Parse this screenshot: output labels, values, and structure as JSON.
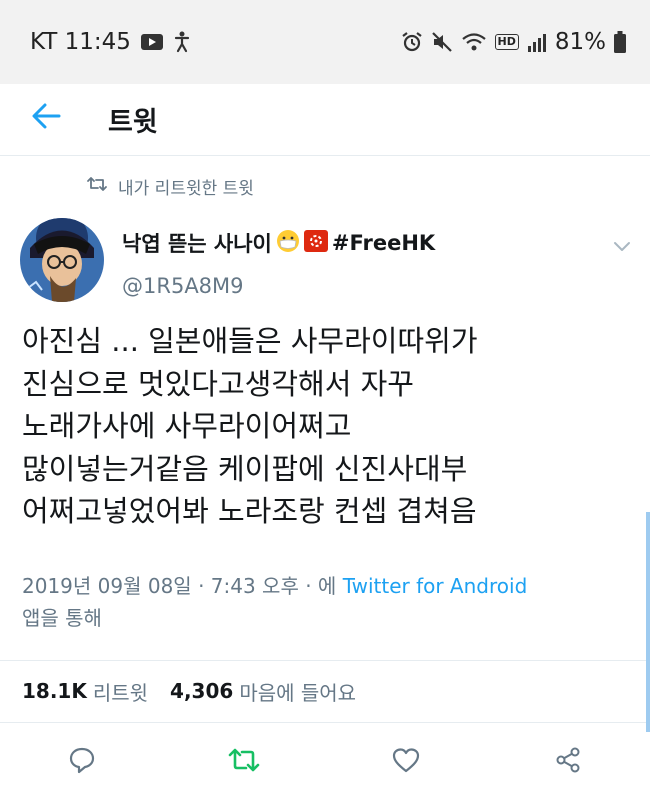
{
  "status_bar": {
    "carrier_time": "KT 11:45",
    "network_badge": "HD",
    "battery": "81%"
  },
  "header": {
    "title": "트윗"
  },
  "retweet_context": "내가 리트윗한 트윗",
  "author": {
    "name": "낙엽 뜯는 사나이",
    "hashtag": "#FreeHK",
    "handle": "@1R5A8M9"
  },
  "tweet": {
    "lines": [
      "아진심 ... 일본애들은 사무라이따위가",
      "진심으로 멋있다고생각해서 자꾸",
      "노래가사에 사무라이어쩌고",
      "많이넣는거같음 케이팝에 신진사대부",
      "어쩌고넣었어봐 노라조랑 컨셉 겹쳐음"
    ]
  },
  "meta": {
    "timestamp": "2019년 09월 08일 · 7:43 오후 · 에",
    "source": "Twitter for Android",
    "via": "앱을 통해"
  },
  "stats": {
    "retweets_count": "18.1K",
    "retweets_label": "리트윗",
    "likes_count": "4,306",
    "likes_label": "마음에 들어요"
  },
  "colors": {
    "accent": "#1da1f2",
    "retweet_active": "#17bf63",
    "muted": "#657786",
    "text": "#14171a"
  },
  "icons": {
    "back": "arrow-left-icon",
    "retweet": "retweet-icon",
    "reply": "reply-icon",
    "like": "heart-icon",
    "share": "share-icon",
    "more": "chevron-down-icon"
  }
}
